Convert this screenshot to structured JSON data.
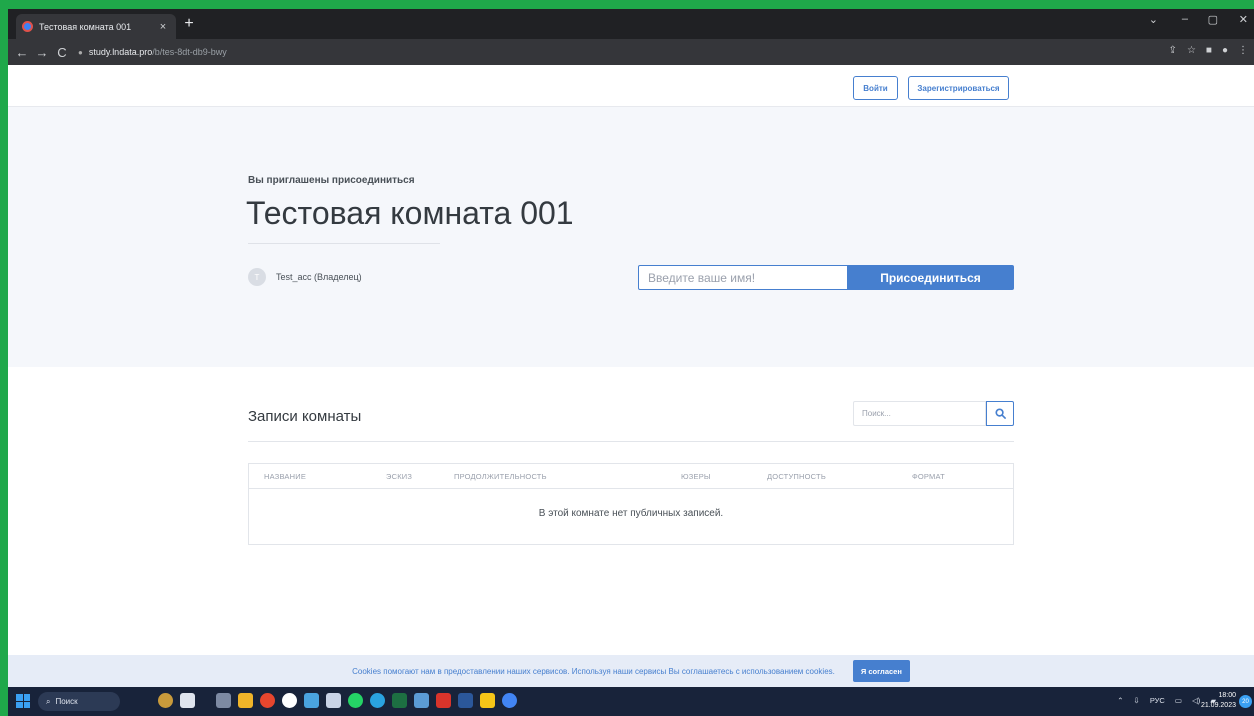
{
  "browser": {
    "tab_title": "Тестовая комната 001",
    "tab_close": "×",
    "new_tab": "+",
    "url_host": "study.lndata.pro",
    "url_path": "/b/tes-8dt-db9-bwy",
    "window_controls": [
      "⌄",
      "–",
      "▢",
      "✕"
    ]
  },
  "topnav": {
    "login_label": "Войти",
    "register_label": "Зарегистрироваться"
  },
  "hero": {
    "invite_text": "Вы приглашены присоединиться",
    "room_name": "Тестовая комната 001",
    "avatar_letter": "T",
    "owner_text": "Test_acc (Владелец)",
    "name_placeholder": "Введите ваше имя!",
    "join_label": "Присоединиться"
  },
  "recordings": {
    "title": "Записи комнаты",
    "search_placeholder": "Поиск...",
    "columns": [
      "Название",
      "Эскиз",
      "Продолжительность",
      "Юзеры",
      "Доступность",
      "Формат"
    ],
    "empty_message": "В этой комнате нет публичных записей."
  },
  "cookie": {
    "text": "Cookies помогают нам в предоставлении наших сервисов. Используя наши сервисы Вы соглашаетесь с использованием cookies.",
    "accept_label": "Я согласен"
  },
  "taskbar": {
    "search_label": "Поиск",
    "lang": "РУС",
    "time": "18:00",
    "date": "21.09.2023",
    "notification_count": "20"
  },
  "colors": {
    "accent": "#467fcf",
    "hero_bg": "#f5f7fb",
    "frame_green": "#1fa84a"
  }
}
